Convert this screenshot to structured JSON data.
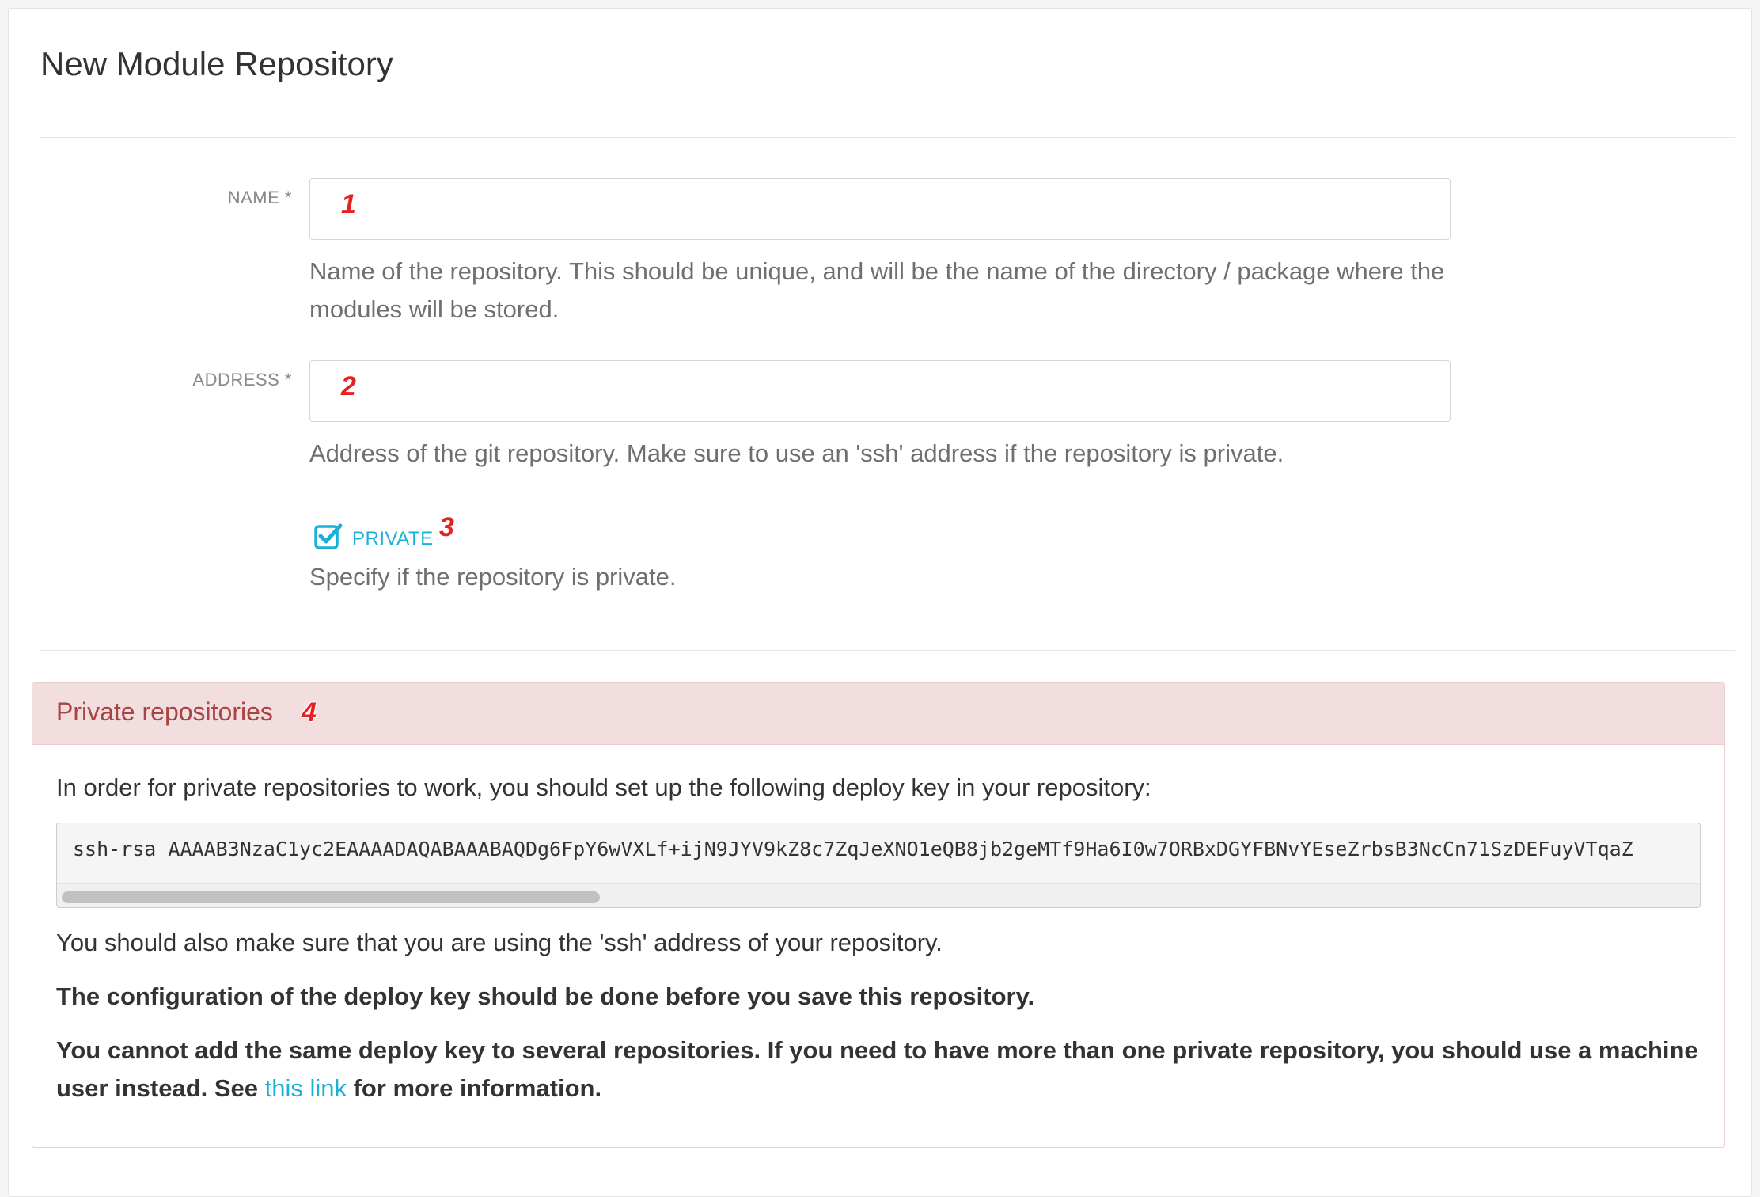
{
  "page": {
    "title": "New Module Repository"
  },
  "form": {
    "name": {
      "label": "NAME *",
      "value": "",
      "help": "Name of the repository. This should be unique, and will be the name of the directory / package where the modules will be stored."
    },
    "address": {
      "label": "ADDRESS *",
      "value": "",
      "help": "Address of the git repository. Make sure to use an 'ssh' address if the repository is private."
    },
    "private": {
      "label": "PRIVATE",
      "checked": true,
      "help": "Specify if the repository is private."
    }
  },
  "markers": [
    "1",
    "2",
    "3",
    "4"
  ],
  "alert": {
    "title": "Private repositories",
    "intro": "In order for private repositories to work, you should set up the following deploy key in your repository:",
    "deploy_key": "ssh-rsa AAAAB3NzaC1yc2EAAAADAQABAAABAQDg6FpY6wVXLf+ijN9JYV9kZ8c7ZqJeXNO1eQB8jb2geMTf9Ha6I0w7ORBxDGYFBNvYEseZrbsB3NcCn71SzDEFuyVTqaZ",
    "ssh_note": "You should also make sure that you are using the 'ssh' address of your repository.",
    "config_note": "The configuration of the deploy key should be done before you save this repository.",
    "warning_before_link": "You cannot add the same deploy key to several repositories. If you need to have more than one private repository, you should use a machine user instead. See ",
    "link_text": "this link",
    "warning_after_link": " for more information."
  },
  "colors": {
    "accent": "#1ab1d8",
    "alert_bg": "#f2dede",
    "alert_text": "#a94442",
    "marker": "#e52222"
  },
  "icons": {
    "private_checkbox": "checkbox-checked-icon"
  }
}
